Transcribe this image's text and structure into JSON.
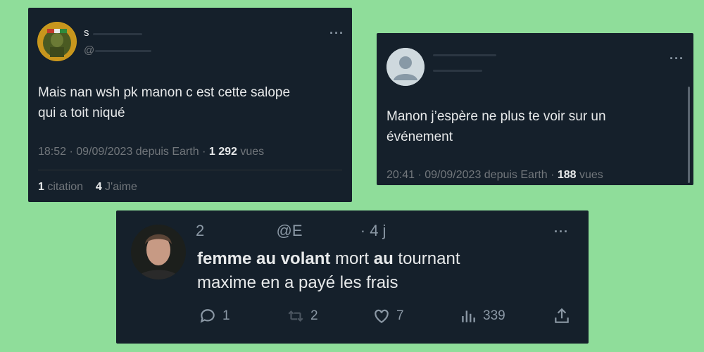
{
  "tweet1": {
    "handle_partial": "@",
    "name_partial": "s",
    "text_line1": "Mais nan wsh pk manon c est cette salope",
    "text_line2": "qui a toit niqué",
    "time": "18:52 · 09/09/2023 depuis Earth · ",
    "views_count": "1 292",
    "views_label": " vues",
    "citations_count": "1",
    "citations_label": " citation",
    "likes_count": "4",
    "likes_label": " J'aime",
    "more": "···"
  },
  "tweet2": {
    "text_line1": "Manon j’espère ne plus te voir sur un",
    "text_line2": "événement",
    "time": "20:41 · 09/09/2023 depuis Earth · ",
    "views_count": "188",
    "views_label": " vues",
    "more": "···"
  },
  "tweet3": {
    "header_partial_start": "2",
    "header_partial_handle": "@E",
    "header_age": "· 4 j",
    "text_bold1": "femme au volant",
    "text_plain1": " mort ",
    "text_bold2": "au",
    "text_plain2": " tournant",
    "text_line2": "maxime en a payé les frais",
    "replies": "1",
    "retweets": "2",
    "likes": "7",
    "views": "339",
    "more": "···"
  },
  "colors": {
    "background": "#8fdd9a",
    "card": "#15202b",
    "text": "#e7e9ea",
    "muted": "#71767b"
  }
}
